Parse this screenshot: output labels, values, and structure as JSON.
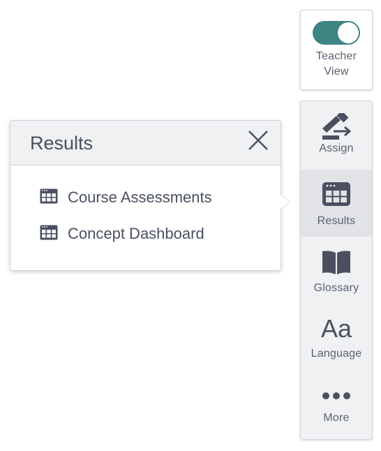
{
  "teacher_view": {
    "label": "Teacher\nView",
    "enabled": true,
    "toggle_color": "#3c8583"
  },
  "rail": {
    "items": [
      {
        "label": "Assign",
        "icon": "assign-icon",
        "active": false
      },
      {
        "label": "Results",
        "icon": "calendar-grid-icon",
        "active": true
      },
      {
        "label": "Glossary",
        "icon": "book-icon",
        "active": false
      },
      {
        "label": "Language",
        "icon": "aa-text-icon",
        "active": false
      },
      {
        "label": "More",
        "icon": "ellipsis-icon",
        "active": false
      }
    ],
    "language_glyph": "Aa"
  },
  "popover": {
    "title": "Results",
    "items": [
      {
        "label": "Course Assessments",
        "icon": "calendar-grid-icon"
      },
      {
        "label": "Concept Dashboard",
        "icon": "calendar-grid-icon"
      }
    ]
  },
  "colors": {
    "icon": "#4a5060",
    "accent": "#3c8583",
    "rail_bg": "#f0f1f3",
    "rail_active": "#e1e3e6"
  }
}
